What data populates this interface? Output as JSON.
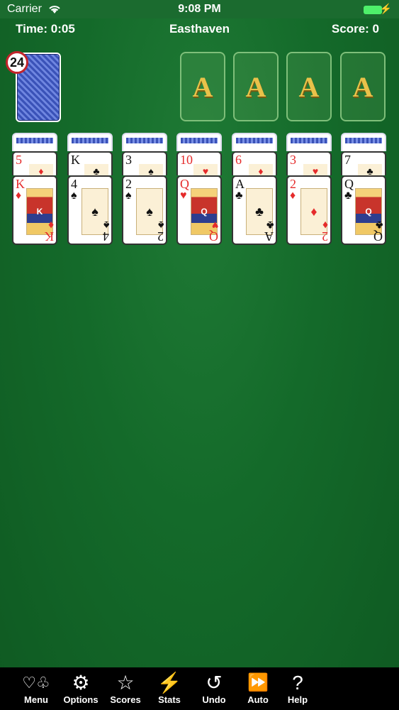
{
  "status_bar": {
    "carrier": "Carrier",
    "time": "9:08 PM"
  },
  "header": {
    "time": "Time: 0:05",
    "title": "Easthaven",
    "score": "Score: 0"
  },
  "stock": {
    "count": "24"
  },
  "foundations": [
    "A",
    "A",
    "A",
    "A"
  ],
  "tableau": [
    {
      "covered": [
        "5",
        "♦"
      ],
      "top": {
        "rank": "K",
        "suit": "♦",
        "face": "K"
      }
    },
    {
      "covered": [
        "K",
        "♣"
      ],
      "top": {
        "rank": "4",
        "suit": "♠",
        "face": "♠"
      }
    },
    {
      "covered": [
        "3",
        "♠"
      ],
      "top": {
        "rank": "2",
        "suit": "♠",
        "face": "♠"
      }
    },
    {
      "covered": [
        "10",
        "♥"
      ],
      "top": {
        "rank": "Q",
        "suit": "♥",
        "face": "Q"
      }
    },
    {
      "covered": [
        "6",
        "♦"
      ],
      "top": {
        "rank": "A",
        "suit": "♣",
        "face": "♣"
      }
    },
    {
      "covered": [
        "3",
        "♥"
      ],
      "top": {
        "rank": "2",
        "suit": "♦",
        "face": "♦"
      }
    },
    {
      "covered": [
        "7",
        "♣"
      ],
      "top": {
        "rank": "Q",
        "suit": "♣",
        "face": "Q"
      }
    }
  ],
  "toolbar": {
    "menu": "Menu",
    "options": "Options",
    "scores": "Scores",
    "stats": "Stats",
    "undo": "Undo",
    "auto": "Auto",
    "help": "Help",
    "icons": {
      "menu": "♡♧",
      "options": "⚙",
      "scores": "☆",
      "stats": "⚡",
      "undo": "↺",
      "auto": "⏩",
      "help": "?"
    }
  },
  "colors": {
    "felt": "#146a2a",
    "red_suit": "#e52b2b",
    "foundation_ace": "#e9c24a"
  }
}
